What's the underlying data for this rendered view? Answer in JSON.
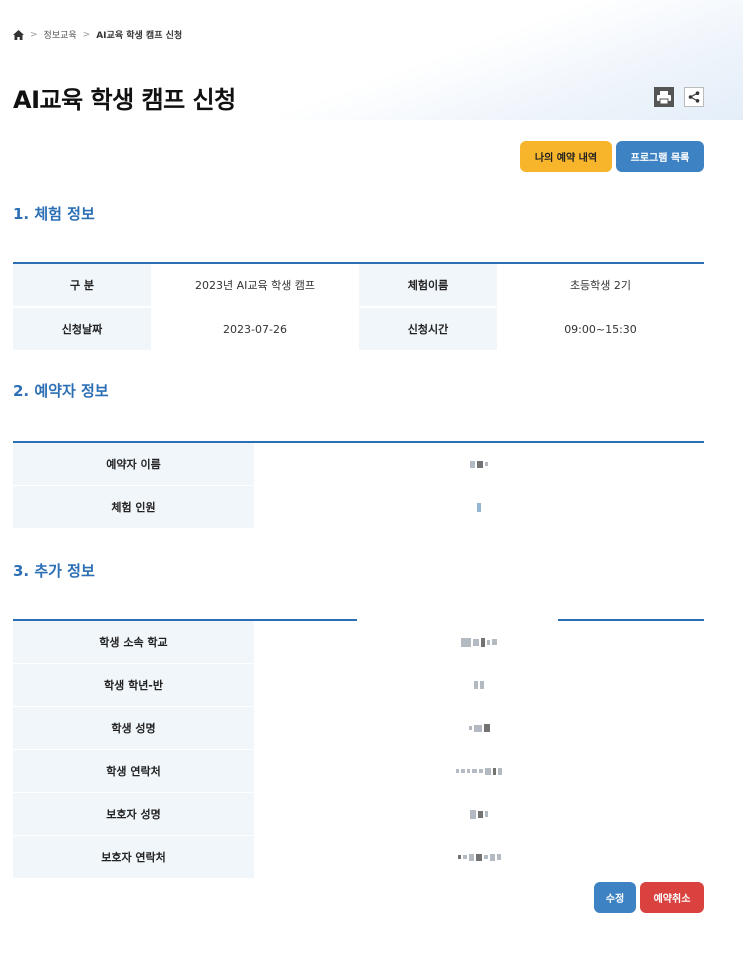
{
  "breadcrumb": {
    "home_icon": "home-icon",
    "items": [
      "정보교육",
      "AI교육 학생 캠프 신청"
    ]
  },
  "page": {
    "title": "AI교육 학생 캠프 신청",
    "print_icon": "print-icon",
    "share_icon": "share-icon"
  },
  "actions": {
    "my_reservations": "나의 예약 내역",
    "program_list": "프로그램 목록",
    "edit": "수정",
    "cancel_reservation": "예약취소"
  },
  "colors": {
    "accent": "#2d6fb5",
    "yellow_button": "#f6b52a",
    "blue_button": "#3d82c2",
    "red_button": "#d9423f",
    "header_cell_bg": "#f1f6fb"
  },
  "section1": {
    "title": "1. 체험 정보",
    "rows": [
      {
        "label1": "구 분",
        "value1": "2023년 AI교육 학생 캠프",
        "label2": "체험이름",
        "value2": "초등학생 2기"
      },
      {
        "label1": "신청날짜",
        "value1": "2023-07-26",
        "label2": "신청시간",
        "value2": "09:00~15:30"
      }
    ]
  },
  "section2": {
    "title": "2. 예약자 정보",
    "rows": [
      {
        "label": "예약자 이름"
      },
      {
        "label": "체험 인원"
      }
    ]
  },
  "section3": {
    "title": "3. 추가 정보",
    "rows": [
      {
        "label": "학생 소속 학교"
      },
      {
        "label": "학생 학년-반"
      },
      {
        "label": "학생 성명"
      },
      {
        "label": "학생 연락처"
      },
      {
        "label": "보호자 성명"
      },
      {
        "label": "보호자 연락처"
      }
    ]
  }
}
